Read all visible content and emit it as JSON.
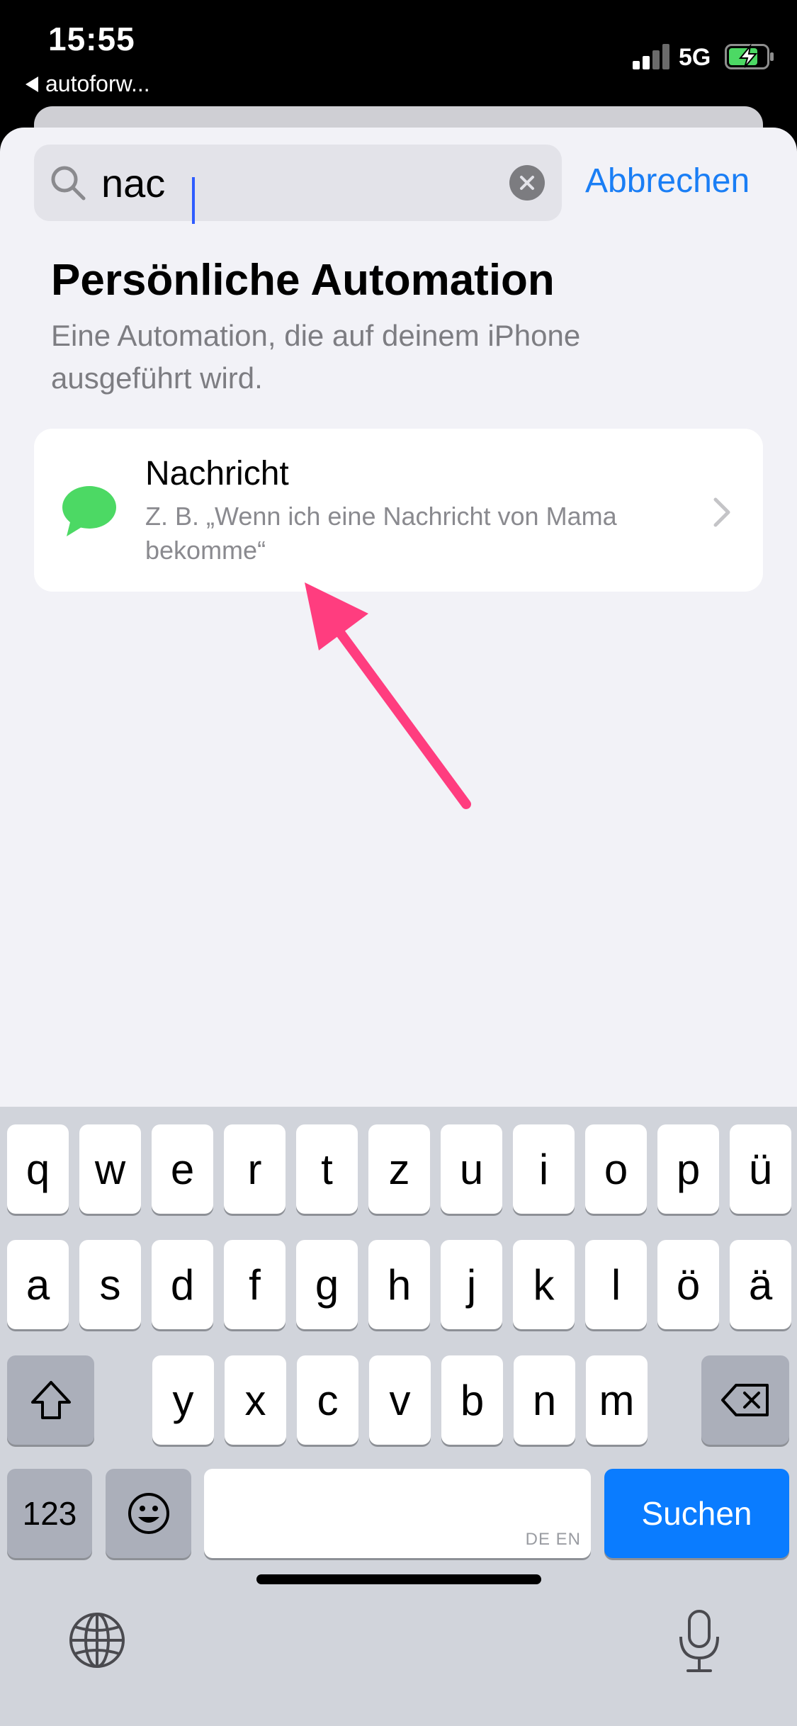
{
  "status_bar": {
    "time": "15:55",
    "back_label": "autoforw...",
    "network": "5G",
    "icons": [
      "signal-icon",
      "battery-charging-icon"
    ]
  },
  "search": {
    "value": "nac",
    "cancel_label": "Abbrechen"
  },
  "section": {
    "title": "Persönliche Automation",
    "subtitle": "Eine Automation, die auf deinem iPhone ausgeführt wird."
  },
  "result": {
    "title": "Nachricht",
    "description": "Z. B. „Wenn ich eine Nachricht von Mama bekomme“",
    "icon": "message-bubble-icon"
  },
  "keyboard": {
    "row1": [
      "q",
      "w",
      "e",
      "r",
      "t",
      "z",
      "u",
      "i",
      "o",
      "p",
      "ü"
    ],
    "row2": [
      "a",
      "s",
      "d",
      "f",
      "g",
      "h",
      "j",
      "k",
      "l",
      "ö",
      "ä"
    ],
    "row3": [
      "y",
      "x",
      "c",
      "v",
      "b",
      "n",
      "m"
    ],
    "numbers_label": "123",
    "space_language": "DE EN",
    "search_label": "Suchen"
  },
  "colors": {
    "accent": "#1a7ef5",
    "message_green": "#4cd964",
    "annotation_pink": "#ff3d7f",
    "search_key": "#0a7cff"
  }
}
